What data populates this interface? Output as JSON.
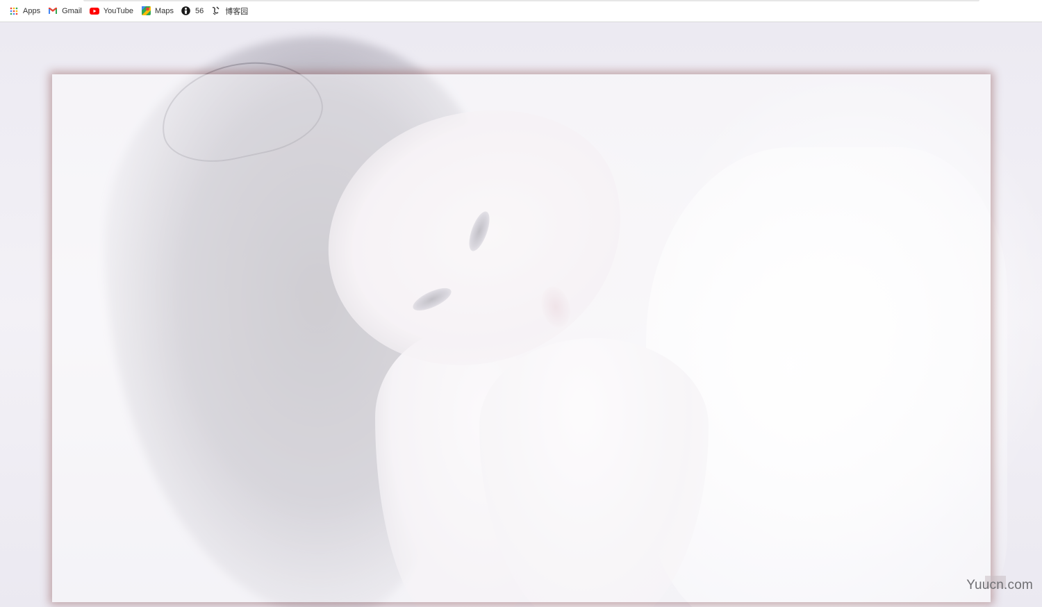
{
  "bookmarks": {
    "items": [
      {
        "label": "Apps",
        "icon": "apps-grid-icon"
      },
      {
        "label": "Gmail",
        "icon": "gmail-icon"
      },
      {
        "label": "YouTube",
        "icon": "youtube-icon"
      },
      {
        "label": "Maps",
        "icon": "maps-icon"
      },
      {
        "label": "56",
        "icon": "site-56-icon"
      },
      {
        "label": "博客园",
        "icon": "cnblogs-icon"
      }
    ]
  },
  "page": {
    "watermark": "Yuucn.com"
  },
  "colors": {
    "frame_shadow": "#8c5050",
    "gmail_red": "#ea4335",
    "youtube_red": "#ff0000"
  }
}
